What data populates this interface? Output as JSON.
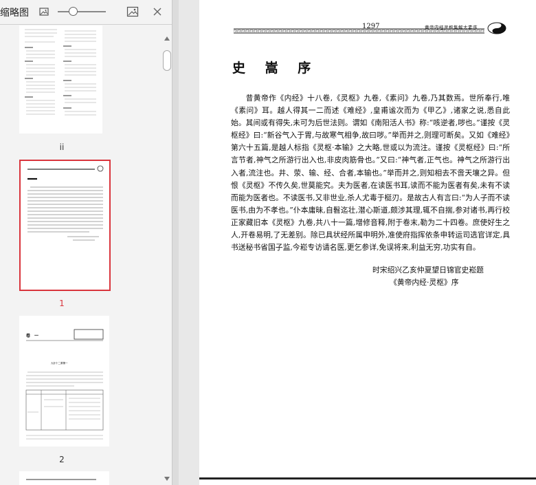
{
  "sidebar": {
    "title": "缩略图",
    "icons": [
      "image-small-icon",
      "image-large-icon",
      "close-icon"
    ],
    "thumbnails": [
      {
        "label": "ii",
        "selected": false
      },
      {
        "label": "1",
        "selected": true
      },
      {
        "label": "2",
        "selected": false
      }
    ],
    "thumb2": {
      "chapter": "卷　一",
      "heading": "九针十二原第一"
    }
  },
  "page": {
    "page_number": "1297",
    "running_header": "黄帝内经灵枢集解太素序",
    "title": "史 嵩 序",
    "body": "昔黄帝作《内经》十八卷,《灵枢》九卷,《素问》九卷,乃其数焉。世所奉行,唯《素问》耳。越人得其一二而述《难经》,皇甫谧次而为《甲乙》,诸家之说,悉自此始。其间或有得失,未可为后世法则。谓如《南阳活人书》称:“咳逆者,哕也。”谨按《灵枢经》曰:“新谷气入于胃,与故寒气相争,故曰哕。”举而并之,则理可断矣。又如《难经》第六十五篇,是越人标指《灵枢·本输》之大略,世或以为流注。谨按《灵枢经》曰:“所言节者,神气之所游行出入也,非皮肉筋骨也。”又曰:“神气者,正气也。神气之所游行出入者,流注也。井、荥、输、经、合者,本输也。”举而并之,则知相去不啻天壤之异。但恨《灵枢》不传久矣,世莫能究。夫为医者,在读医书耳,读而不能为医者有矣,未有不读而能为医者也。不读医书,又非世业,杀人尤毒于梃刃。是故古人有言曰:“为人子而不读医书,由为不孝也。”仆本庸昧,自髫迄壮,潜心斯道,颇涉其理,辄不自揣,参对诸书,再行校正家藏旧本《灵枢》九卷,共八十一篇,增修音释,附于卷末,勒为二十四卷。庶使好生之人,开卷易明,了无差别。除已具状经所属申明外,准使府指挥依条申转运司选官详定,具书送秘书省国子监,今崧专访请名医,更乞参详,免误将来,利益无穷,功实有自。",
    "signature_line1": "时宋绍兴乙亥仲夏望日锦官史崧题",
    "signature_line2": "《黄帝内经·灵枢》序"
  }
}
